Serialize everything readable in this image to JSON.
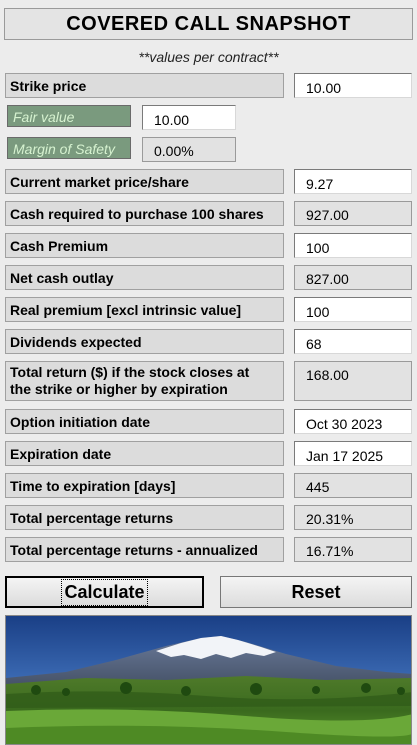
{
  "title": "COVERED CALL SNAPSHOT",
  "subtitle": "**values per contract**",
  "fields": {
    "strike_price": {
      "label": "Strike price",
      "value": "10.00"
    },
    "fair_value": {
      "label": "Fair value",
      "value": "10.00"
    },
    "margin_of_safety": {
      "label": "Margin of Safety",
      "value": "0.00%"
    },
    "current_market_price": {
      "label": "Current market price/share",
      "value": "9.27"
    },
    "cash_required": {
      "label": "Cash required to purchase 100 shares",
      "value": "927.00"
    },
    "cash_premium": {
      "label": "Cash Premium",
      "value": "100"
    },
    "net_cash_outlay": {
      "label": "Net cash outlay",
      "value": "827.00"
    },
    "real_premium": {
      "label": "Real premium [excl intrinsic value]",
      "value": "100"
    },
    "dividends_expected": {
      "label": "Dividends expected",
      "value": "68"
    },
    "total_return": {
      "label_line1": "Total return ($) if the stock closes at",
      "label_line2": "the strike or higher by expiration",
      "value": "168.00"
    },
    "option_initiation_date": {
      "label": "Option initiation date",
      "value": "Oct 30 2023"
    },
    "expiration_date": {
      "label": "Expiration date",
      "value": "Jan 17 2025"
    },
    "time_to_expiration": {
      "label": "Time to expiration [days]",
      "value": "445"
    },
    "total_pct_returns": {
      "label": "Total percentage returns",
      "value": "20.31%"
    },
    "total_pct_returns_annualized": {
      "label": "Total percentage returns - annualized",
      "value": "16.71%"
    }
  },
  "buttons": {
    "calculate": "Calculate",
    "reset": "Reset"
  },
  "colors": {
    "green_label_bg": "#7a9a7e",
    "green_label_text": "#d6f2d0",
    "panel_bg": "#ececec"
  }
}
